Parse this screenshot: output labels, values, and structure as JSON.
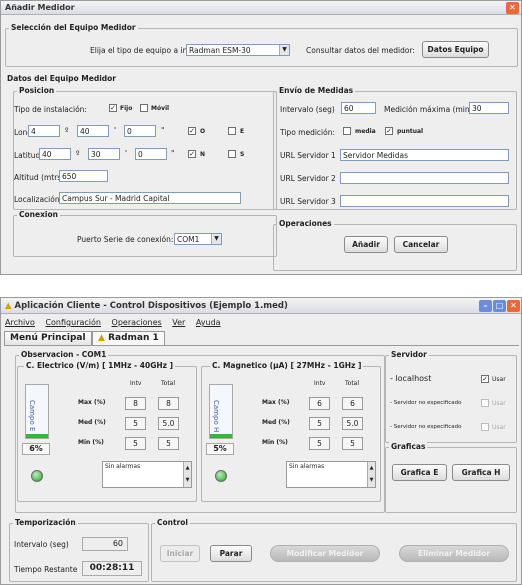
{
  "dialog": {
    "title": "Añadir Medidor",
    "sel_title": "Selección del Equipo Medidor",
    "eq_label": "Elija el tipo de equipo a instalar:",
    "eq_value": "Radman ESM-30",
    "consult_label": "Consultar datos del medidor:",
    "datos_btn": "Datos Equipo",
    "datos_title": "Datos del Equipo Medidor",
    "pos_title": "Posicion",
    "tipo_label": "Tipo de instalación:",
    "fijo": "Fijo",
    "movil": "Móvil",
    "long_label": "Longitud",
    "long": [
      "4",
      "40",
      "0"
    ],
    "lat_label": "Latitud",
    "lat": [
      "40",
      "30",
      "0"
    ],
    "deg": "º",
    "min": "'",
    "sec": "\"",
    "o": "O",
    "e": "E",
    "n": "N",
    "s": "S",
    "alt_label": "Altitud (mtrs)",
    "alt": "650",
    "loc_label": "Localización:",
    "loc": "Campus Sur - Madrid Capital",
    "con_title": "Conexion",
    "puerto_label": "Puerto Serie de conexión:",
    "puerto": "COM1",
    "env_title": "Envío de Medidas",
    "int_label": "Intervalo (seg)",
    "int": "60",
    "max_label": "Medición máxima (min)",
    "max": "30",
    "tmed_label": "Tipo medición:",
    "media": "media",
    "puntual": "puntual",
    "url1_label": "URL Servidor 1",
    "url1": "Servidor Medidas",
    "url2_label": "URL Servidor 2",
    "url3_label": "URL Servidor 3",
    "ops_title": "Operaciones",
    "add_btn": "Añadir",
    "cancel_btn": "Cancelar"
  },
  "app": {
    "title": "Aplicación Cliente - Control Dispositivos (Ejemplo 1.med)",
    "menu": [
      "Archivo",
      "Configuración",
      "Operaciones",
      "Ver",
      "Ayuda"
    ],
    "tab1": "Menú Principal",
    "tab2": "Radman 1",
    "obs_title": "Observacion - COM1",
    "e_title": "C. Electrico (V/m) [ 1MHz - 40GHz ]",
    "h_title": "C. Magnetico (µA) [ 27MHz - 1GHz ]",
    "intv": "Intv",
    "total": "Total",
    "maxl": "Max (%)",
    "medl": "Med (%)",
    "minl": "Min (%)",
    "e_vals": [
      "8",
      "8",
      "5",
      "5.0",
      "5",
      "5"
    ],
    "h_vals": [
      "6",
      "6",
      "5",
      "5.0",
      "5",
      "5"
    ],
    "campo_e": "Campo E",
    "campo_h": "Campo H",
    "e_pct": "6%",
    "h_pct": "5%",
    "alarm": "Sin alarmas",
    "srv_title": "Servidor",
    "srv1": "- localhost",
    "srv2": "- Servidor no especificado",
    "srv3": "- Servidor no especificado",
    "usar": "Usar",
    "graf_title": "Graficas",
    "graf_e": "Grafica E",
    "graf_h": "Grafica H",
    "temp_title": "Temporización",
    "tint_label": "Intervalo (seg)",
    "tint": "60",
    "trest_label": "Tiempo Restante",
    "trest": "00:28:11",
    "ctrl_title": "Control",
    "iniciar": "Iniciar",
    "parar": "Parar",
    "nuevo": "Modificar Medidor",
    "eliminar": "Eliminar Medidor"
  }
}
